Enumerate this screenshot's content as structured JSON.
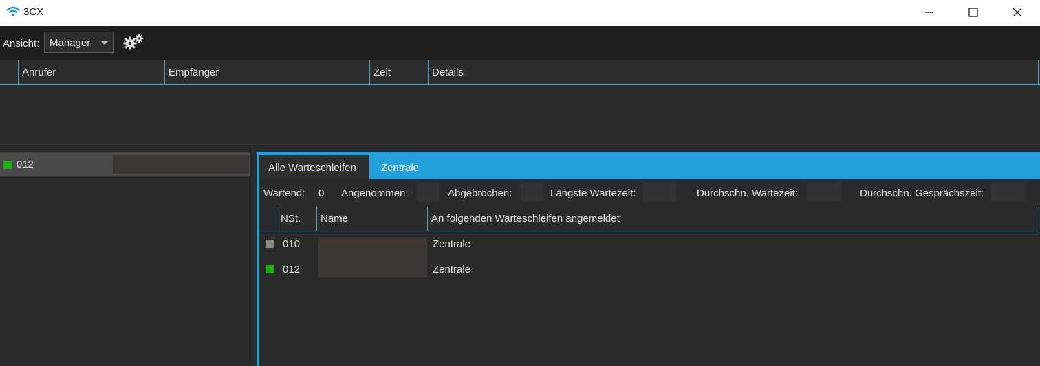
{
  "window": {
    "title": "3CX"
  },
  "toolbar": {
    "view_label": "Ansicht:",
    "view_value": "Manager"
  },
  "calls_table": {
    "columns": [
      "Anrufer",
      "Empfänger",
      "Zeit",
      "Details"
    ]
  },
  "left_panel": {
    "items": [
      {
        "ext": "012",
        "status_color": "#1fb010"
      }
    ]
  },
  "queue_tabs": [
    "Alle Warteschleifen",
    "Zentrale"
  ],
  "stats": {
    "waiting_label": "Wartend:",
    "waiting_value": "0",
    "accepted_label": "Angenommen:",
    "abandoned_label": "Abgebrochen:",
    "longest_wait_label": "Längste Wartezeit:",
    "avg_wait_label": "Durchschn. Wartezeit:",
    "avg_talk_label": "Durchschn. Gesprächszeit:"
  },
  "agents_table": {
    "columns": [
      "NSt.",
      "Name",
      "An folgenden Warteschleifen angemeldet"
    ],
    "rows": [
      {
        "ext": "010",
        "queues": "Zentrale",
        "status_color": "#8a8a8a"
      },
      {
        "ext": "012",
        "queues": "Zentrale",
        "status_color": "#1fb010"
      }
    ]
  },
  "colors": {
    "accent": "#23a0dc",
    "online": "#1fb010",
    "offline": "#8a8a8a"
  }
}
